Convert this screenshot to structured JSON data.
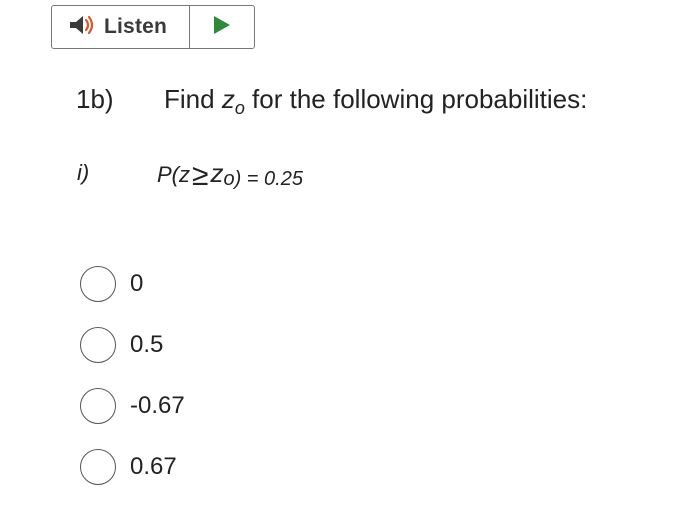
{
  "listen_button": {
    "label": "Listen",
    "speaker_icon": "speaker-icon",
    "play_icon": "play-icon"
  },
  "question": {
    "number": "1b)",
    "text_prefix": "Find ",
    "var": "z",
    "var_sub": "o",
    "text_suffix": " for the following probabilities:"
  },
  "subpart": {
    "label": "i)",
    "expr_left": "P(z",
    "geq": "≥",
    "expr_var": "z",
    "expr_right": "o) = 0.25"
  },
  "options": [
    "0",
    "0.5",
    "-0.67",
    "0.67"
  ],
  "colors": {
    "play_green": "#2f8a3a",
    "speaker_dark": "#3a3a3a",
    "speaker_accent": "#d9572a"
  }
}
